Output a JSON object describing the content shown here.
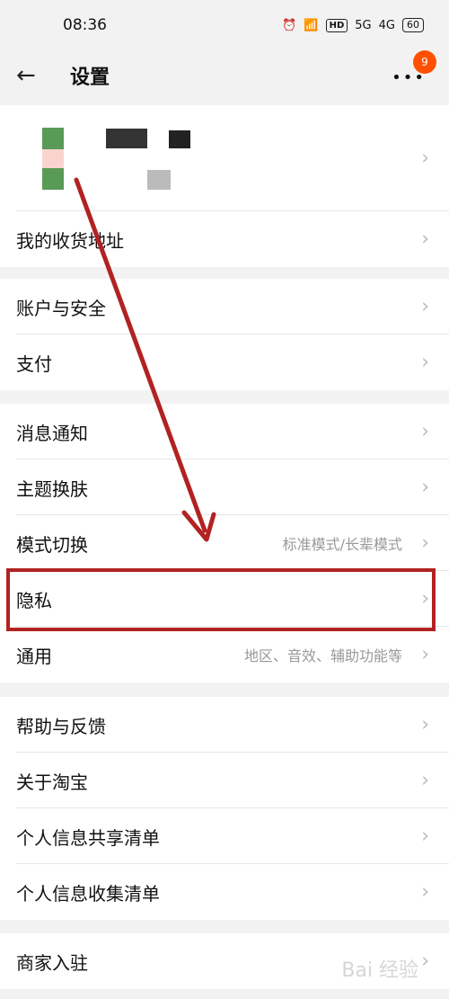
{
  "status_bar": {
    "time": "08:36",
    "icons": {
      "alarm": "⏰",
      "wifi": "📶",
      "hd": "HD",
      "sig1": "5G",
      "sig2": "4G"
    },
    "battery": "60"
  },
  "header": {
    "title": "设置",
    "badge": "9"
  },
  "sections": {
    "s1": {
      "address": "我的收货地址"
    },
    "s2": {
      "account": "账户与安全",
      "pay": "支付"
    },
    "s3": {
      "notify": "消息通知",
      "theme": "主题换肤",
      "mode": "模式切换",
      "mode_value": "标准模式/长辈模式",
      "privacy": "隐私",
      "general": "通用",
      "general_value": "地区、音效、辅助功能等"
    },
    "s4": {
      "help": "帮助与反馈",
      "about": "关于淘宝",
      "share_list": "个人信息共享清单",
      "collect_list": "个人信息收集清单"
    },
    "s5": {
      "merchant": "商家入驻"
    }
  },
  "watermark": "Bai 经验",
  "colors": {
    "accent": "#ff5000",
    "highlight": "#b22222"
  }
}
